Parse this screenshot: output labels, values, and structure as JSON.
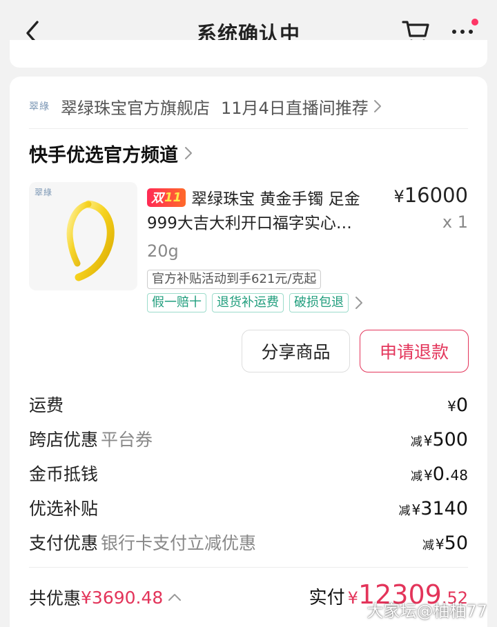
{
  "nav": {
    "title": "系统确认中",
    "icons": [
      "back-arrow-icon",
      "cart-icon",
      "more-icon"
    ],
    "notification_dot_color": "#fe3666"
  },
  "shop": {
    "logo_text": "翠綠",
    "name": "翠绿珠宝官方旗舰店",
    "live_recommend": "11月4日直播间推荐"
  },
  "channel": {
    "label": "快手优选官方频道"
  },
  "product": {
    "image_logo_text": "翠綠",
    "badge_text": "双",
    "badge_exclaim": "11",
    "title_line1": "翠绿珠宝 黄金手镯 足金",
    "title_line2": "999大吉大利开口福字实心…",
    "spec": "20g",
    "price_symbol": "¥",
    "price": "16000",
    "qty": "x 1",
    "subsidy_tag": "官方补贴活动到手621元/克起",
    "service_tags": [
      "假一赔十",
      "退货补运费",
      "破损包退"
    ]
  },
  "actions": {
    "share_label": "分享商品",
    "refund_label": "申请退款"
  },
  "fees": {
    "shipping": {
      "label": "运费",
      "yen": "¥",
      "value": "0"
    },
    "cross_store": {
      "label": "跨店优惠",
      "sub": "平台券",
      "prefix": "减",
      "yen": "¥",
      "value": "500"
    },
    "coins": {
      "label": "金币抵钱",
      "prefix": "减",
      "yen": "¥",
      "value_int": "0.",
      "value_dec": "48"
    },
    "subsidy": {
      "label": "优选补贴",
      "prefix": "减",
      "yen": "¥",
      "value": "3140"
    },
    "payment": {
      "label": "支付优惠",
      "sub": "银行卡支付立减优惠",
      "prefix": "减",
      "yen": "¥",
      "value": "50"
    }
  },
  "summary": {
    "total_discount_label": "共优惠",
    "total_discount_amount": "¥3690.48",
    "paid_label": "实付",
    "paid_yen": "¥",
    "paid_int": "12309",
    "paid_dec": ".52"
  },
  "watermark": "大家坛@柚柚77",
  "colors": {
    "accent_red": "#e3345a",
    "service_green": "#1f9d7c",
    "badge_gradient": [
      "#ff2a55",
      "#ff6a2a"
    ]
  }
}
